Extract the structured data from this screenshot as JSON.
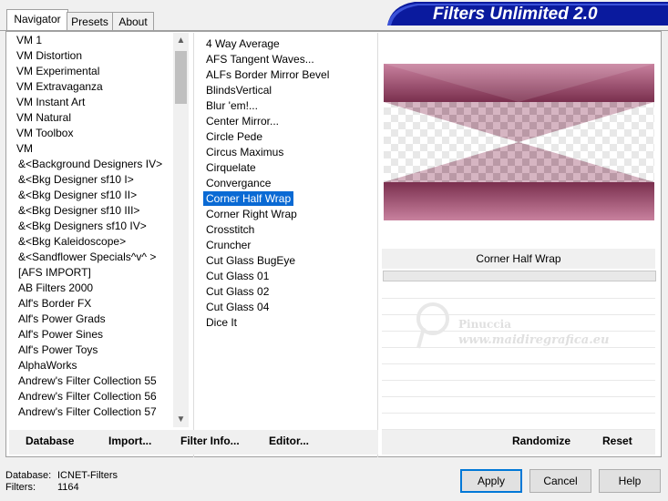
{
  "tabs": [
    {
      "label": "Navigator"
    },
    {
      "label": "Presets"
    },
    {
      "label": "About"
    }
  ],
  "title": "Filters Unlimited 2.0",
  "categories": [
    "VM 1",
    "VM Distortion",
    "VM Experimental",
    "VM Extravaganza",
    "VM Instant Art",
    "VM Natural",
    "VM Toolbox",
    "VM",
    "&<Background Designers IV>",
    "&<Bkg Designer sf10 I>",
    "&<Bkg Designer sf10 II>",
    "&<Bkg Designer sf10 III>",
    "&<Bkg Designers sf10 IV>",
    "&<Bkg Kaleidoscope>",
    "&<Sandflower Specials^v^ >",
    "[AFS IMPORT]",
    "AB Filters 2000",
    "Alf's Border FX",
    "Alf's Power Grads",
    "Alf's Power Sines",
    "Alf's Power Toys",
    "AlphaWorks",
    "Andrew's Filter Collection 55",
    "Andrew's Filter Collection 56",
    "Andrew's Filter Collection 57"
  ],
  "filters": [
    "4 Way Average",
    "AFS Tangent Waves...",
    "ALFs Border Mirror Bevel",
    "BlindsVertical",
    "Blur 'em!...",
    "Center Mirror...",
    "Circle Pede",
    "Circus Maximus",
    "Cirquelate",
    "Convergance",
    "Corner Half Wrap",
    "Corner Right Wrap",
    "Crosstitch",
    "Cruncher",
    "Cut Glass  BugEye",
    "Cut Glass 01",
    "Cut Glass 02",
    "Cut Glass 04",
    "Dice It"
  ],
  "selected_filter": "Corner Half Wrap",
  "selected_filter_index": 10,
  "watermark": {
    "line1": "Pinuccia",
    "line2": "www.maidiregrafica.eu"
  },
  "buttons": {
    "database": "Database",
    "import": "Import...",
    "filter_info": "Filter Info...",
    "editor": "Editor...",
    "randomize": "Randomize",
    "reset": "Reset",
    "apply": "Apply",
    "cancel": "Cancel",
    "help": "Help"
  },
  "status": {
    "database_label": "Database:",
    "database_value": "ICNET-Filters",
    "filters_label": "Filters:",
    "filters_value": "1164"
  },
  "colors": {
    "accent": "#0a6ad4",
    "banner": "#0a1a9e",
    "preview_rose": "#a35a78"
  }
}
